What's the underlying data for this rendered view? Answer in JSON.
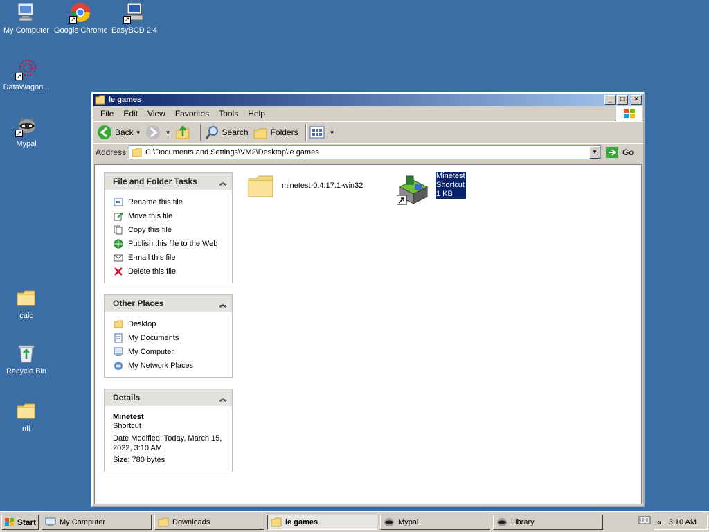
{
  "desktop": {
    "icons": [
      {
        "label": "My Computer"
      },
      {
        "label": "Google Chrome"
      },
      {
        "label": "EasyBCD 2.4"
      },
      {
        "label": "DataWagon..."
      },
      {
        "label": "Mypal"
      },
      {
        "label": "calc"
      },
      {
        "label": "Recycle Bin"
      },
      {
        "label": "nft"
      }
    ]
  },
  "window": {
    "title": "le games",
    "menu": [
      "File",
      "Edit",
      "View",
      "Favorites",
      "Tools",
      "Help"
    ],
    "toolbar": {
      "back": "Back",
      "search": "Search",
      "folders": "Folders"
    },
    "address": {
      "label": "Address",
      "value": "C:\\Documents and Settings\\VM2\\Desktop\\le games",
      "go": "Go"
    },
    "panels": {
      "tasks": {
        "title": "File and Folder Tasks",
        "items": [
          "Rename this file",
          "Move this file",
          "Copy this file",
          "Publish this file to the Web",
          "E-mail this file",
          "Delete this file"
        ]
      },
      "places": {
        "title": "Other Places",
        "items": [
          "Desktop",
          "My Documents",
          "My Computer",
          "My Network Places"
        ]
      },
      "details": {
        "title": "Details",
        "name": "Minetest",
        "type": "Shortcut",
        "modified_1": "Date Modified: Today, March 15,",
        "modified_2": "2022, 3:10 AM",
        "size": "Size: 780 bytes"
      }
    },
    "files": [
      {
        "name": "minetest-0.4.17.1-win32"
      },
      {
        "name_line1": "Minetest",
        "name_line2": "Shortcut",
        "name_line3": "1 KB"
      }
    ]
  },
  "taskbar": {
    "start": "Start",
    "tasks": [
      "My Computer",
      "Downloads",
      "le games",
      "Mypal",
      "Library"
    ],
    "clock": "3:10 AM",
    "tray_chevron": "«"
  }
}
